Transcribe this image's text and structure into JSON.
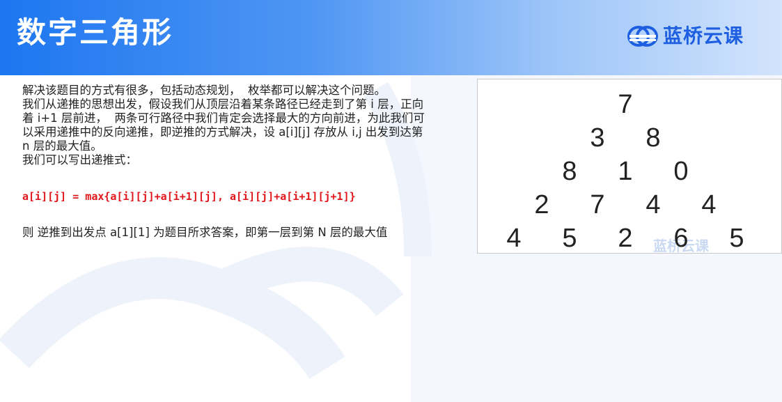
{
  "header": {
    "title": "数字三角形",
    "brand": "蓝桥云课"
  },
  "content": {
    "paragraphs": [
      "解决该题目的方式有很多，包括动态规划，  枚举都可以解决这个问题。",
      "我们从递推的思想出发，假设我们从顶层沿着某条路径已经走到了第 i 层，正向着 i+1 层前进，  两条可行路径中我们肯定会选择最大的方向前进，为此我们可以采用递推中的反向递推，即逆推的方式解决，设 a[i][j] 存放从 i,j 出发到达第 n 层的最大值。",
      "我们可以写出递推式："
    ],
    "formula": "a[i][j] = max{a[i][j]+a[i+1][j], a[i][j]+a[i+1][j+1]}",
    "conclusion": "则 逆推到出发点 a[1][1] 为题目所求答案，即第一层到第 N 层的最大值"
  },
  "triangle": {
    "rows": [
      [
        "7"
      ],
      [
        "3",
        "8"
      ],
      [
        "8",
        "1",
        "0"
      ],
      [
        "2",
        "7",
        "4",
        "4"
      ],
      [
        "4",
        "5",
        "2",
        "6",
        "5"
      ]
    ],
    "watermark": "蓝桥云课"
  },
  "colors": {
    "header_start": "#1d76f0",
    "header_end": "#d2e4fc",
    "brand": "#1d5fe0",
    "formula": "#e0161b"
  }
}
